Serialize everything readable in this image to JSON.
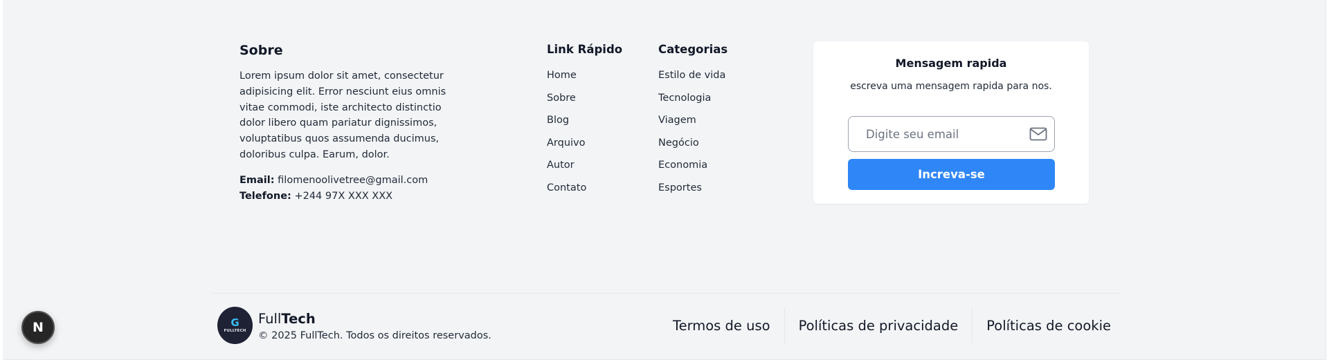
{
  "about": {
    "title": "Sobre",
    "description": "Lorem ipsum dolor sit amet, consectetur adipisicing elit. Error nesciunt eius omnis vitae commodi, iste architecto distinctio dolor libero quam pariatur dignissimos, voluptatibus quos assumenda ducimus, doloribus culpa. Earum, dolor.",
    "email_label": "Email:",
    "email_value": "filomenoolivetree@gmail.com",
    "phone_label": "Telefone:",
    "phone_value": "+244 97X XXX XXX"
  },
  "quick_links": {
    "title": "Link Rápido",
    "items": [
      "Home",
      "Sobre",
      "Blog",
      "Arquivo",
      "Autor",
      "Contato"
    ]
  },
  "categories": {
    "title": "Categorias",
    "items": [
      "Estilo de vida",
      "Tecnologia",
      "Viagem",
      "Negócio",
      "Economia",
      "Esportes"
    ]
  },
  "newsletter": {
    "title": "Mensagem rapida",
    "subtitle": "escreva uma mensagem rapida para nos.",
    "email_placeholder": "Digite seu email",
    "email_icon": "mail-icon",
    "button_label": "Increva-se",
    "button_color": "#2f86f6"
  },
  "footer": {
    "logo_mark": "G",
    "logo_text": "FULLTECH",
    "brand_light": "Full",
    "brand_bold": "Tech",
    "copyright": "© 2025 FullTech. Todos os direitos reservados.",
    "links": [
      "Termos de uso",
      "Políticas de privacidade",
      "Políticas de cookie"
    ]
  },
  "dev_badge": {
    "label": "N"
  }
}
